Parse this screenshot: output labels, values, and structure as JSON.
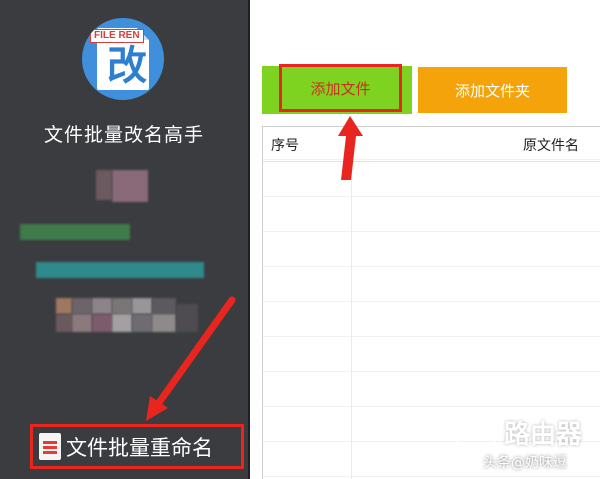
{
  "sidebar": {
    "logo_tag": "FILE REN",
    "logo_char": "改",
    "app_title": "文件批量改名高手",
    "rename_label": "文件批量重命名"
  },
  "toolbar": {
    "add_file_label": "添加文件",
    "add_folder_label": "添加文件夹"
  },
  "table": {
    "columns": [
      "序号",
      "原文件名"
    ],
    "rows": []
  },
  "watermark": {
    "brand": "路由器",
    "credit": "头条@奶味逗"
  },
  "colors": {
    "sidebar_bg": "#3a3c40",
    "add_file_bg": "#7ed321",
    "add_folder_bg": "#f4a40a",
    "annotation_red": "#e8251f"
  }
}
